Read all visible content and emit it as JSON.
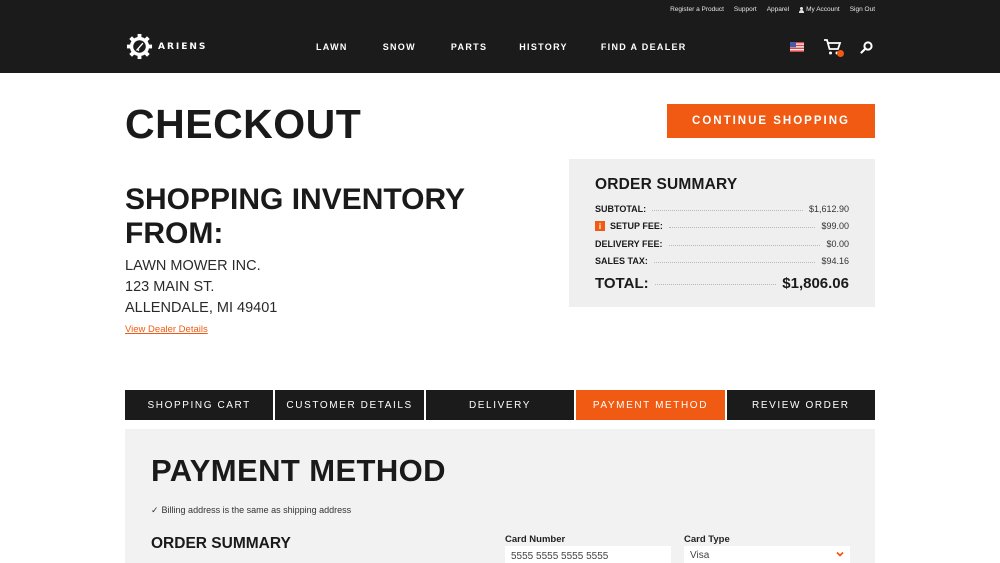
{
  "header": {
    "utility_links": [
      "Register a Product",
      "Support",
      "Apparel",
      "My Account",
      "Sign Out"
    ],
    "logo_text": "ARIENS",
    "nav": [
      "LAWN",
      "SNOW",
      "PARTS",
      "HISTORY",
      "FIND A DEALER"
    ],
    "icons": [
      "us-flag-icon",
      "cart-icon",
      "search-icon"
    ]
  },
  "page": {
    "title": "CHECKOUT",
    "continue_label": "CONTINUE SHOPPING"
  },
  "dealer": {
    "heading": "SHOPPING INVENTORY FROM:",
    "name": "LAWN MOWER INC.",
    "street": "123 MAIN ST.",
    "city": "ALLENDALE, MI 49401",
    "link": "View Dealer Details"
  },
  "summary": {
    "title": "ORDER SUMMARY",
    "rows": [
      {
        "label": "SUBTOTAL:",
        "value": "$1,612.90"
      },
      {
        "label": "SETUP FEE:",
        "value": "$99.00",
        "info": "i"
      },
      {
        "label": "DELIVERY FEE:",
        "value": "$0.00"
      },
      {
        "label": "SALES TAX:",
        "value": "$94.16"
      }
    ],
    "total_label": "TOTAL:",
    "total_value": "$1,806.06"
  },
  "steps": [
    {
      "label": "SHOPPING CART",
      "active": false
    },
    {
      "label": "CUSTOMER DETAILS",
      "active": false
    },
    {
      "label": "DELIVERY",
      "active": false
    },
    {
      "label": "PAYMENT METHOD",
      "active": true
    },
    {
      "label": "REVIEW ORDER",
      "active": false
    }
  ],
  "payment": {
    "title": "PAYMENT METHOD",
    "billing_check": "✓",
    "billing_text": "Billing address is the same as shipping address",
    "order_summary_title": "ORDER SUMMARY",
    "card_number_label": "Card Number",
    "card_number_value": "5555 5555 5555 5555",
    "card_type_label": "Card Type",
    "card_type_value": "Visa"
  },
  "colors": {
    "accent": "#f05a12",
    "header_bg": "#1b1b1b",
    "panel_bg": "#efefef"
  }
}
